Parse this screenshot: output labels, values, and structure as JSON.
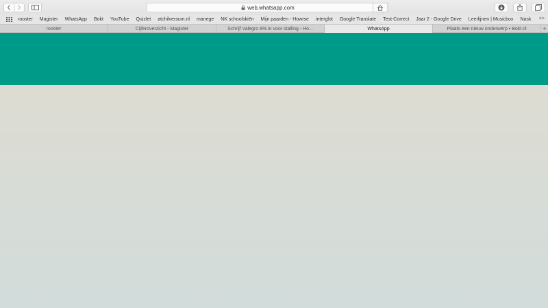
{
  "browser": {
    "url": "web.whatsapp.com",
    "icons": {
      "back": "chevron-left-icon",
      "forward": "chevron-right-icon",
      "sidebar": "sidebar-icon",
      "lock": "lock-icon",
      "reload": "reload-icon",
      "home": "home-icon",
      "downloads": "download-icon",
      "share": "share-icon",
      "tabs": "tabs-overview-icon"
    }
  },
  "bookmarks": [
    "rooster",
    "Magister",
    "WhatsApp",
    "Bokt",
    "YouTube",
    "Quizlet",
    "atchilversum.nl",
    "manege",
    "NK schoolskiën",
    "Mijn paarden - Howrse",
    "interglot",
    "Google Translate",
    "Test-Correct",
    "Jaar 2 - Google Drive",
    "Leerlijnen | Musicbox",
    "Nask"
  ],
  "bookmarks_more": ">>",
  "tabs": [
    {
      "label": "rooster",
      "active": false
    },
    {
      "label": "Cijferoverzicht - Magister",
      "active": false
    },
    {
      "label": "Schrijf Valegro 8%  in voor stalling - Ho...",
      "active": false
    },
    {
      "label": "WhatsApp",
      "active": true
    },
    {
      "label": "Plaats een nieuw onderwerp • Bokt.nl",
      "active": false
    }
  ],
  "tab_add": "+",
  "colors": {
    "header": "#009a88",
    "body_top": "#dddcd2",
    "body_bottom": "#d2dcdb"
  }
}
